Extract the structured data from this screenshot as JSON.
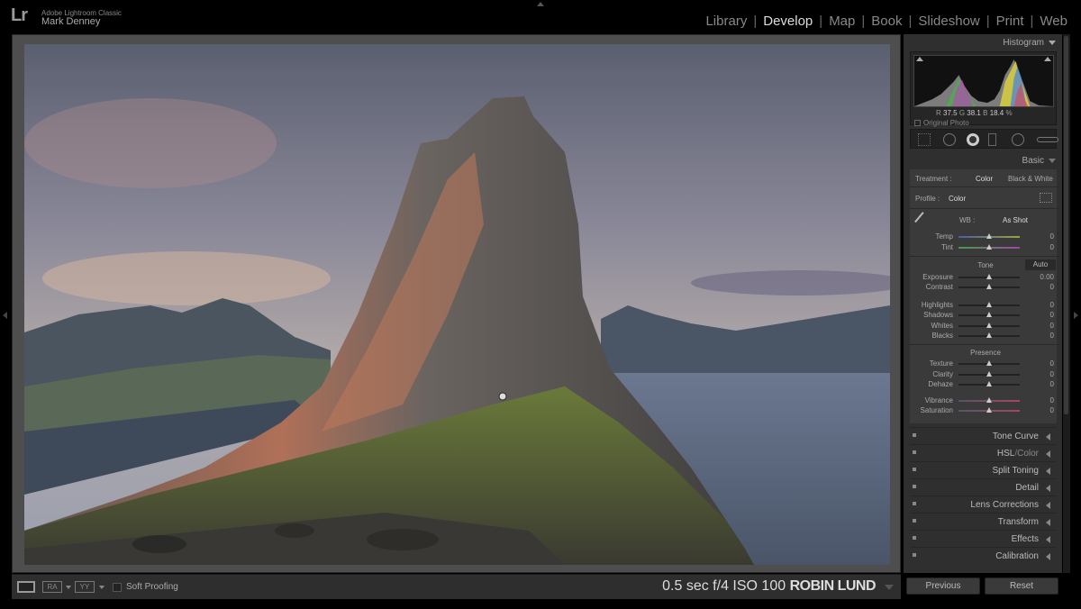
{
  "app": {
    "logo": "Lr",
    "name": "Adobe Lightroom Classic",
    "user": "Mark Denney"
  },
  "modules": [
    "Library",
    "Develop",
    "Map",
    "Book",
    "Slideshow",
    "Print",
    "Web"
  ],
  "active_module": "Develop",
  "toolbar": {
    "view_ra": "RA",
    "view_yy": "YY",
    "soft_proofing": "Soft Proofing",
    "exif": "0.5 sec  f/4  ISO 100",
    "photographer": "ROBIN LUND"
  },
  "histogram": {
    "title": "Histogram",
    "r_label": "R",
    "r_value": "37.5",
    "g_label": "G",
    "g_value": "38.1",
    "b_label": "B",
    "b_value": "18.4",
    "unit": "%",
    "original_photo": "Original Photo"
  },
  "basic": {
    "title": "Basic",
    "treatment_label": "Treatment :",
    "treatment_color": "Color",
    "treatment_bw": "Black & White",
    "profile_label": "Profile :",
    "profile_value": "Color",
    "wb_label": "WB :",
    "wb_value": "As Shot",
    "tone_label": "Tone",
    "auto_label": "Auto",
    "presence_label": "Presence",
    "sliders": {
      "temp": {
        "label": "Temp",
        "value": "0"
      },
      "tint": {
        "label": "Tint",
        "value": "0"
      },
      "exposure": {
        "label": "Exposure",
        "value": "0.00"
      },
      "contrast": {
        "label": "Contrast",
        "value": "0"
      },
      "highlights": {
        "label": "Highlights",
        "value": "0"
      },
      "shadows": {
        "label": "Shadows",
        "value": "0"
      },
      "whites": {
        "label": "Whites",
        "value": "0"
      },
      "blacks": {
        "label": "Blacks",
        "value": "0"
      },
      "texture": {
        "label": "Texture",
        "value": "0"
      },
      "clarity": {
        "label": "Clarity",
        "value": "0"
      },
      "dehaze": {
        "label": "Dehaze",
        "value": "0"
      },
      "vibrance": {
        "label": "Vibrance",
        "value": "0"
      },
      "saturation": {
        "label": "Saturation",
        "value": "0"
      }
    }
  },
  "panels": {
    "tone_curve": "Tone Curve",
    "hsl": "HSL",
    "hsl_sep": "/",
    "hsl_color": "Color",
    "split_toning": "Split Toning",
    "detail": "Detail",
    "lens_corrections": "Lens Corrections",
    "transform": "Transform",
    "effects": "Effects",
    "calibration": "Calibration"
  },
  "buttons": {
    "previous": "Previous",
    "reset": "Reset"
  }
}
